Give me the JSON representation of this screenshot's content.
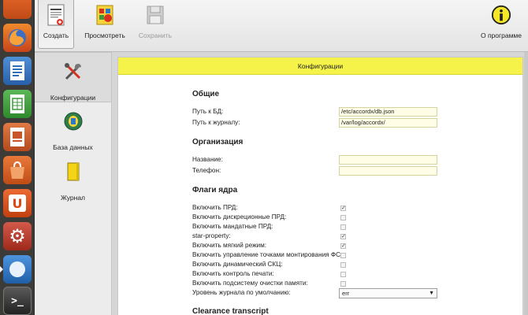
{
  "launcher": {
    "items": [
      {
        "name": "launcher-top-app-icon",
        "color": "#d9531e",
        "glyph": ""
      },
      {
        "name": "firefox-icon",
        "color": "#e0631d",
        "glyph": "◎"
      },
      {
        "name": "writer-icon",
        "color": "#2f6fb6",
        "glyph": "≣"
      },
      {
        "name": "calc-icon",
        "color": "#3d9a3a",
        "glyph": "▦"
      },
      {
        "name": "impress-icon",
        "color": "#c8562a",
        "glyph": "▤"
      },
      {
        "name": "software-center-icon",
        "color": "#d9531e",
        "glyph": "◧"
      },
      {
        "name": "ubuntu-one-icon",
        "color": "#dd4814",
        "glyph": "U"
      },
      {
        "name": "settings-icon",
        "color": "#c0392b",
        "glyph": "⚙"
      },
      {
        "name": "blue-app-icon",
        "color": "#2d77c8",
        "glyph": "◐"
      },
      {
        "name": "terminal-icon",
        "color": "#2b2b2b",
        "glyph": ">_"
      }
    ]
  },
  "toolbar": {
    "create_label": "Создать",
    "view_label": "Просмотреть",
    "save_label": "Сохранить",
    "about_label": "О программе"
  },
  "nav": {
    "items": [
      {
        "label": "Конфигурации",
        "icon": "tools-icon"
      },
      {
        "label": "База данных",
        "icon": "database-icon"
      },
      {
        "label": "Журнал",
        "icon": "journal-icon"
      }
    ]
  },
  "panel": {
    "title": "Конфигурации",
    "general": {
      "heading": "Общие",
      "db_path_label": "Путь к БД:",
      "db_path_value": "/etc/accordx/db.json",
      "log_path_label": "Путь к журналу:",
      "log_path_value": "/var/log/accordx/"
    },
    "org": {
      "heading": "Организация",
      "name_label": "Название:",
      "name_value": "",
      "phone_label": "Телефон:",
      "phone_value": ""
    },
    "flags": {
      "heading": "Флаги ядра",
      "items": [
        {
          "label": "Включить ПРД:",
          "checked": true
        },
        {
          "label": "Включить дискреционные ПРД:",
          "checked": false
        },
        {
          "label": "Включить мандатные ПРД:",
          "checked": false
        },
        {
          "label": "star-property:",
          "checked": true
        },
        {
          "label": "Включить мягкий режим:",
          "checked": true
        },
        {
          "label": "Включить управление точками монтирования ФС:",
          "checked": false
        },
        {
          "label": "Включить динамический СКЦ:",
          "checked": false
        },
        {
          "label": "Включить контроль печати:",
          "checked": false
        },
        {
          "label": "Включить подсистему очистки памяти:",
          "checked": false
        }
      ],
      "log_level_label": "Уровень журнала по умолчанию:",
      "log_level_value": "err"
    },
    "clearance": {
      "heading": "Clearance transcript"
    }
  },
  "colors": {
    "header_yellow": "#f5f34a",
    "field_bg": "#fffde6"
  }
}
